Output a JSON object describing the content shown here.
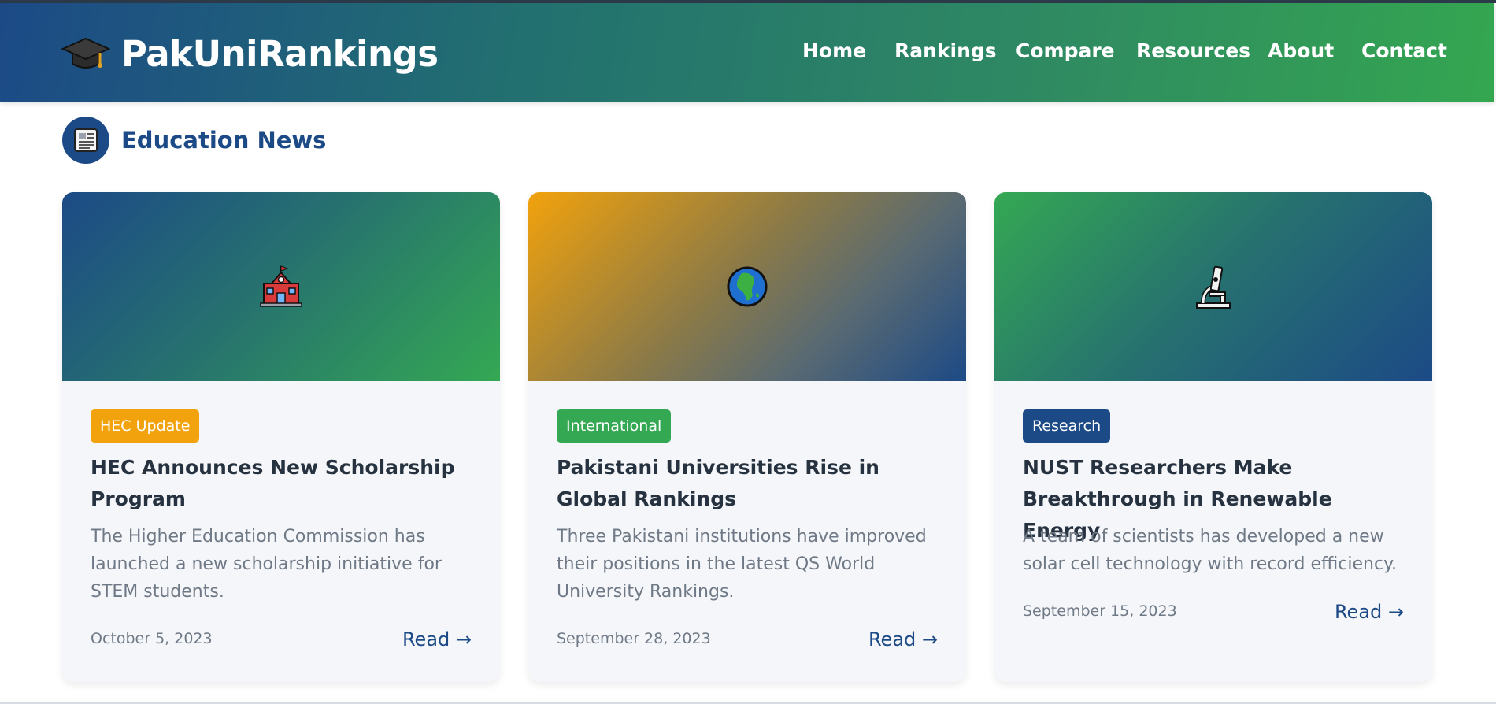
{
  "header": {
    "brand_name": "PakUniRankings",
    "logo_icon": "graduation-cap-icon",
    "nav": [
      {
        "label": "Home"
      },
      {
        "label": "Rankings"
      },
      {
        "label": "Compare"
      },
      {
        "label": "Resources"
      },
      {
        "label": "About"
      },
      {
        "label": "Contact"
      }
    ]
  },
  "section": {
    "title": "Education News",
    "icon": "newspaper-icon"
  },
  "cards": [
    {
      "icon": "school-icon",
      "badge": "HEC Update",
      "badge_color": "#f2a20c",
      "title": "HEC Announces New Scholarship Program",
      "body": "The Higher Education Commission has launched a new scholarship initiative for STEM students.",
      "date": "October 5, 2023",
      "read": "Read →"
    },
    {
      "icon": "globe-africa-icon",
      "badge": "International",
      "badge_color": "#35a853",
      "title": "Pakistani Universities Rise in Global Rankings",
      "body": "Three Pakistani institutions have improved their positions in the latest QS World University Rankings.",
      "date": "September 28, 2023",
      "read": "Read →"
    },
    {
      "icon": "microscope-icon",
      "badge": "Research",
      "badge_color": "#1c4a86",
      "title": "NUST Researchers Make Breakthrough in Renewable Energy",
      "body": "A team of scientists has developed a new solar cell technology with record efficiency.",
      "date": "September 15, 2023",
      "read": "Read →"
    }
  ],
  "colors": {
    "primary": "#1c4a86",
    "secondary": "#35a853",
    "accent": "#f2a20c"
  }
}
